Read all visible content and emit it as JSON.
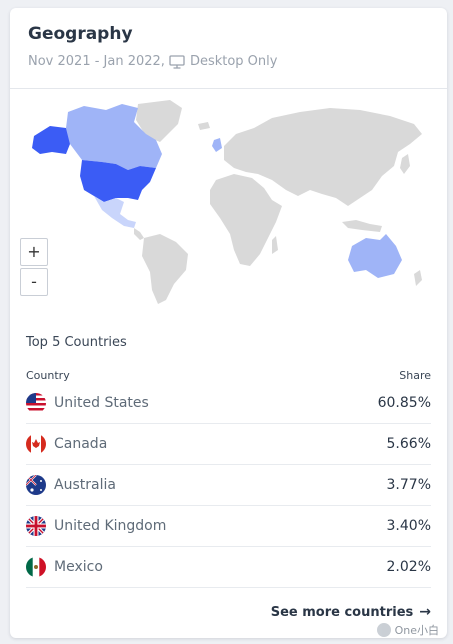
{
  "card": {
    "title": "Geography",
    "date_range": "Nov 2021 - Jan 2022,",
    "device": "Desktop Only",
    "device_icon": "monitor-icon"
  },
  "map": {
    "zoom_in_label": "+",
    "zoom_out_label": "-",
    "colors": {
      "land": "#d9d9d9",
      "top": "#3b5cf5",
      "mid": "#9fb4f7",
      "light": "#c9d5fb"
    },
    "highlighted": [
      "United States",
      "Canada",
      "Australia",
      "United Kingdom",
      "Mexico"
    ]
  },
  "table": {
    "section_title": "Top 5 Countries",
    "col_country": "Country",
    "col_share": "Share",
    "rows": [
      {
        "country": "United States",
        "share": "60.85%",
        "flag": "us-flag-icon"
      },
      {
        "country": "Canada",
        "share": "5.66%",
        "flag": "ca-flag-icon"
      },
      {
        "country": "Australia",
        "share": "3.77%",
        "flag": "au-flag-icon"
      },
      {
        "country": "United Kingdom",
        "share": "3.40%",
        "flag": "uk-flag-icon"
      },
      {
        "country": "Mexico",
        "share": "2.02%",
        "flag": "mx-flag-icon"
      }
    ]
  },
  "footer": {
    "see_more": "See more countries",
    "watermark": "One小白"
  }
}
